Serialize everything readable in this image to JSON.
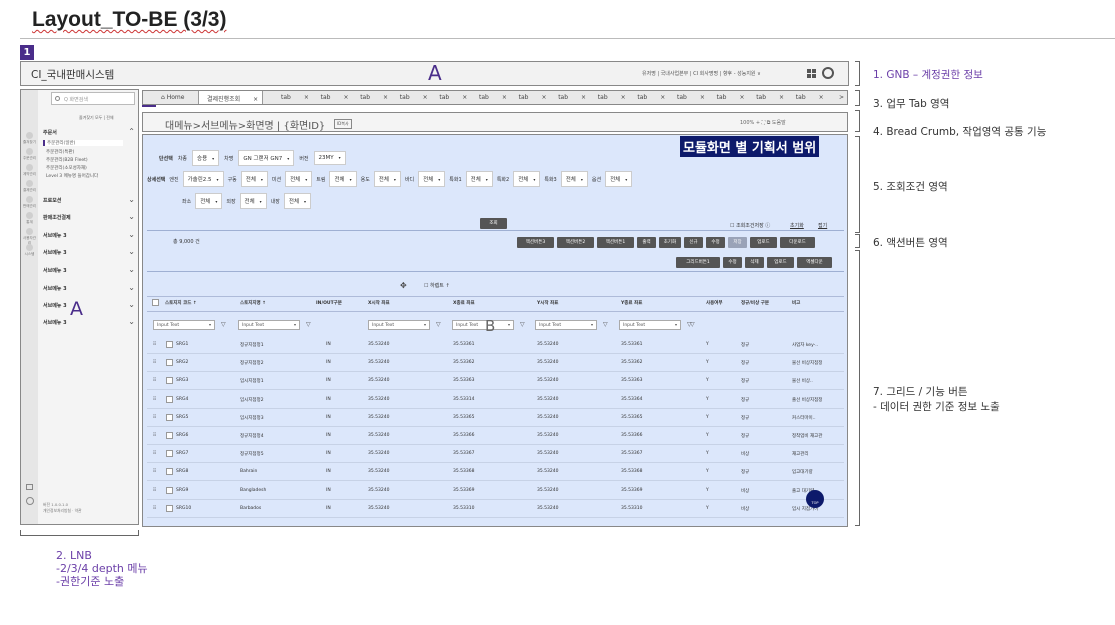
{
  "page_title": "Layout_TO-BE (3/3)",
  "markers": {
    "m1": "1",
    "m2": "2",
    "m3": "3",
    "m4": "4",
    "m5": "5",
    "m6": "6",
    "m7": "7"
  },
  "gnb": {
    "logo": "CI_국내판매시스템",
    "zone_letter": "A",
    "util_text": "유저명 | 국내사업본부 | CI 회사명명 | 향후 - 성능지원 ∨",
    "icons": [
      "grid-icon",
      "user-icon"
    ]
  },
  "lnb": {
    "search_placeholder": "Q 화면검색",
    "links": "즐겨찾기 모두 | 전체",
    "rail": [
      "즐겨찾기",
      "주문관리",
      "계약관리",
      "결제관리",
      "판매관리",
      "통계",
      "사용자관리",
      "시스템"
    ],
    "groups": [
      {
        "label": "주문서",
        "open": true
      },
      {
        "label": "프로모션",
        "open": false
      },
      {
        "label": "판매조건결제",
        "open": false
      },
      {
        "label": "서브메뉴 3",
        "open": false
      },
      {
        "label": "서브메뉴 3",
        "open": false
      },
      {
        "label": "서브메뉴 3",
        "open": false
      },
      {
        "label": "서브메뉴 3",
        "open": false
      },
      {
        "label": "서브메뉴 3",
        "open": false
      },
      {
        "label": "서브메뉴 3",
        "open": false
      }
    ],
    "subs": [
      "주문관리(일반)",
      "주문관리(특판)",
      "주문관리(B2B Fleet)",
      "주문관리(소모성자재)",
      "Level 3 메뉴명 들어갑니다"
    ],
    "zone_letter": "A",
    "footer": [
      "버전 1.0.0.1.0",
      "개인정보처리방침 · 약관"
    ]
  },
  "tabs": {
    "home": "Home",
    "active": "결제진행조회",
    "items": [
      "tab",
      "tab",
      "tab",
      "tab",
      "tab",
      "tab",
      "tab",
      "tab",
      "tab",
      "tab",
      "tab",
      "tab",
      "tab",
      "tab"
    ],
    "close": "×",
    "more": ">"
  },
  "breadcrumb": {
    "path": "대메뉴>서브메뉴>화면명  |  {화면ID}",
    "badge": "ID복사",
    "right": "100%  +  ⛶  ⧉   도움말"
  },
  "scope_label": "모듈화면 별 기획서 범위",
  "conditions": {
    "row1": [
      {
        "label": "차종",
        "value": "승용"
      },
      {
        "label": "차명",
        "value": "GN 그랜저 GN7"
      },
      {
        "label": "버전",
        "value": "23MY"
      }
    ],
    "row1_header": "단선택",
    "row2_header": "상세선택",
    "row2": [
      {
        "label": "엔진",
        "value": "가솔린2.5"
      },
      {
        "label": "구동",
        "value": "전체"
      },
      {
        "label": "미션",
        "value": "전체"
      },
      {
        "label": "트림",
        "value": "전체"
      },
      {
        "label": "용도",
        "value": "전체"
      },
      {
        "label": "바디",
        "value": "전체"
      },
      {
        "label": "특화1",
        "value": "전체"
      },
      {
        "label": "특화2",
        "value": "전체"
      },
      {
        "label": "특화3",
        "value": "전체"
      },
      {
        "label": "옵션",
        "value": "전체"
      }
    ],
    "row3": [
      {
        "label": "좌소",
        "value": "전체"
      },
      {
        "label": "외장",
        "value": "전체"
      },
      {
        "label": "내장",
        "value": "전체"
      }
    ],
    "search_btn": "조회",
    "save_cond": "조회조건저장 ⓘ",
    "reset": "초기화",
    "fold": "접기"
  },
  "actions": {
    "total": "총 9,000 건",
    "buttons": [
      "액션버튼3",
      "액션버튼2",
      "액션버튼1",
      "출력",
      "초기화",
      "신규",
      "수정",
      "저장",
      "업로드",
      "다운로드"
    ]
  },
  "grid": {
    "buttons": [
      "그리드버튼1",
      "수정",
      "삭제",
      "업로드",
      "엑셀다운"
    ],
    "fixed_label": "하렙트 ↑",
    "zone_letter": "B",
    "headers": [
      "스토지지 코드 ↑",
      "스토지지명 ↑",
      "IN/OUT구분",
      "X시작 좌표",
      "X종료 좌표",
      "Y시작 좌표",
      "Y종료 좌표",
      "사용여부",
      "정규/비상 구분",
      "비고"
    ],
    "filter_text": "Input Text",
    "rows": [
      [
        "SRG1",
        "정규지점정1",
        "IN",
        "35.53240",
        "35.53361",
        "35.53240",
        "35.53361",
        "Y",
        "정규",
        "사업자 key-.."
      ],
      [
        "SRG2",
        "정규지점정2",
        "IN",
        "35.53240",
        "35.53362",
        "35.53240",
        "35.53362",
        "Y",
        "정규",
        "물선 비상지점정"
      ],
      [
        "SRG3",
        "임시지점정1",
        "IN",
        "35.53240",
        "35.53363",
        "35.53240",
        "35.53363",
        "Y",
        "정규",
        "물선 비상.."
      ],
      [
        "SRG4",
        "임시지점정2",
        "IN",
        "35.53240",
        "35.53314",
        "35.53240",
        "35.53364",
        "Y",
        "정규",
        "출선 비상지점정"
      ],
      [
        "SRG5",
        "임시지점정3",
        "IN",
        "35.53240",
        "35.53365",
        "35.53240",
        "35.53365",
        "Y",
        "정규",
        "커스터마이.."
      ],
      [
        "SRG6",
        "정규지점정4",
        "IN",
        "35.53240",
        "35.53366",
        "35.53240",
        "35.53366",
        "Y",
        "정규",
        "정착업비 재고관"
      ],
      [
        "SRG7",
        "정규지점정5",
        "IN",
        "35.53240",
        "35.53367",
        "35.53240",
        "35.53367",
        "Y",
        "비상",
        "재고관리"
      ],
      [
        "SRG8",
        "Bahrain",
        "IN",
        "35.53240",
        "35.53368",
        "35.53240",
        "35.53368",
        "Y",
        "정규",
        "입고대기량"
      ],
      [
        "SRG9",
        "Bangladesh",
        "IN",
        "35.53240",
        "35.53369",
        "35.53240",
        "35.53369",
        "Y",
        "비상",
        "출고 대기량"
      ],
      [
        "SRG10",
        "Barbados",
        "IN",
        "35.53240",
        "35.53310",
        "35.53240",
        "35.53310",
        "Y",
        "비상",
        "임시 지점가이"
      ]
    ],
    "row_handle": "⠿",
    "top_label": "TOP"
  },
  "annotations": [
    {
      "text": "1. GNB – 계정권한 정보",
      "color": "#6b3fa8"
    },
    {
      "text": "3. 업무 Tab 영역",
      "color": "#333"
    },
    {
      "text": "4. Bread Crumb, 작업영역 공통 기능",
      "color": "#333"
    },
    {
      "text": "5. 조회조건 영역",
      "color": "#333"
    },
    {
      "text": "6. 액션버튼 영역",
      "color": "#333"
    },
    {
      "text": "7. 그리드 / 기능 버튼",
      "color": "#333"
    },
    {
      "text": "- 데이터 권한 기준 정보 노출",
      "color": "#333"
    }
  ],
  "lnb_note": [
    "2. LNB",
    "-2/3/4 depth 메뉴",
    "-권한기준 노출"
  ]
}
